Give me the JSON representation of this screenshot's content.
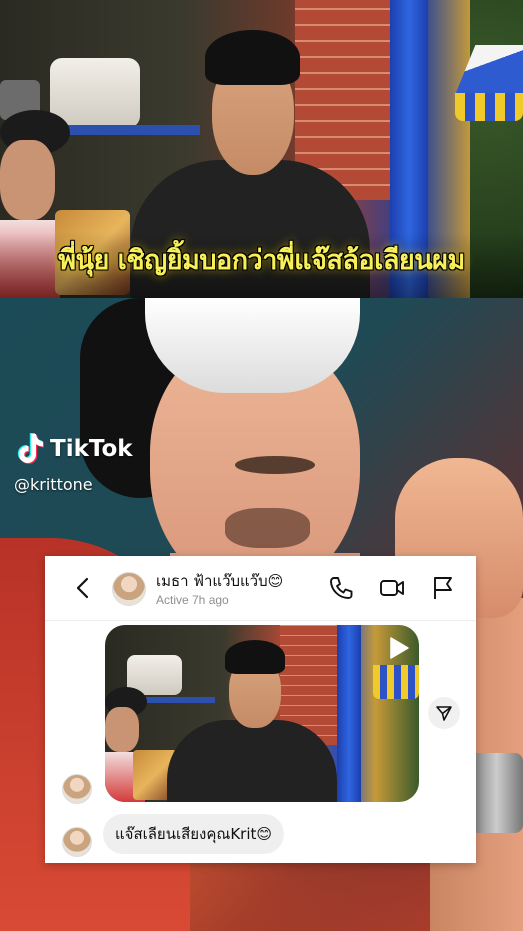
{
  "video_top": {
    "caption": "พี่นุ้ย เชิญยิ้มบอกว่าพี่แจ๊สล้อเลียนผม"
  },
  "watermark": {
    "brand": "TikTok",
    "handle": "@krittone"
  },
  "dm": {
    "contact_name": "เมธา ฟ้าแว๊บแว๊บ😊",
    "status": "Active 7h ago",
    "message": "แจ๊สเลียนเสียงคุณKrit😊",
    "icons": {
      "back": "chevron-left-icon",
      "call": "phone-icon",
      "video": "video-camera-icon",
      "report": "flag-icon",
      "share": "send-icon",
      "reel": "play-icon"
    }
  },
  "colors": {
    "caption_yellow": "#f8f05a",
    "card_bg": "#ffffff",
    "bubble_bg": "#efefef",
    "status_gray": "#8e8e8e"
  }
}
